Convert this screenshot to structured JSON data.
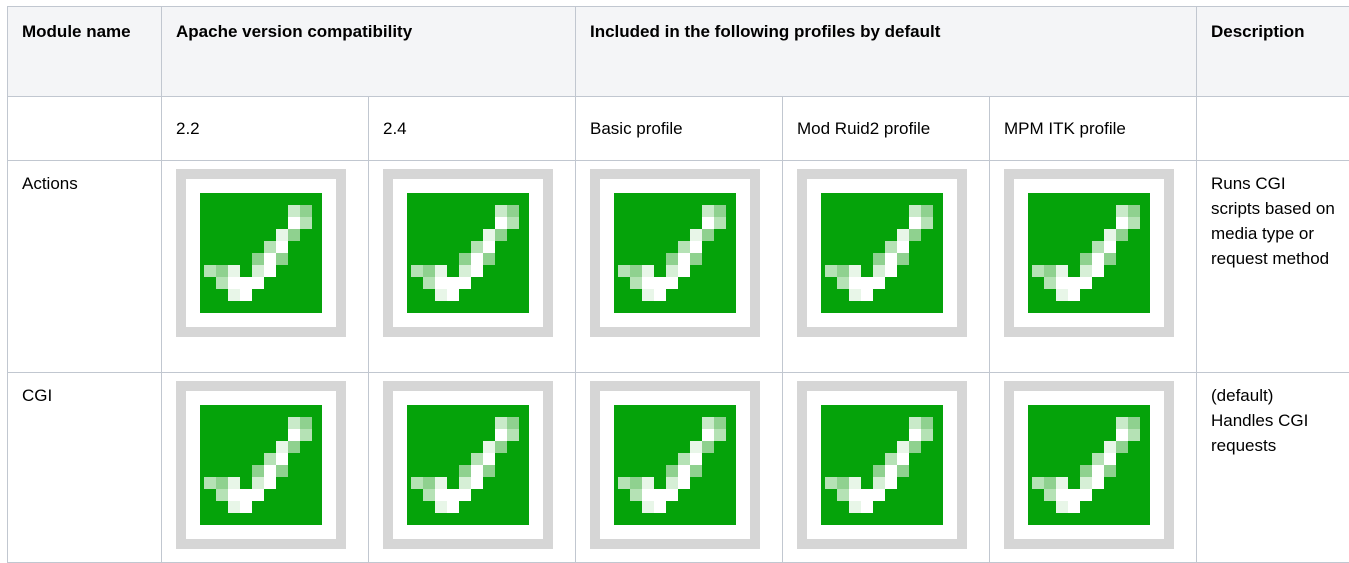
{
  "table": {
    "headers": {
      "module_name": "Module name",
      "apache_version": "Apache version compatibility",
      "profiles": "Included in the following profiles by default",
      "description": "Description"
    },
    "subheaders": {
      "module_name": "",
      "v22": "2.2",
      "v24": "2.4",
      "basic": "Basic profile",
      "ruid2": "Mod Ruid2 profile",
      "itk": "MPM ITK profile",
      "description": ""
    },
    "rows": [
      {
        "module": "Actions",
        "v22": "check-icon",
        "v24": "check-icon",
        "basic": "check-icon",
        "ruid2": "check-icon",
        "itk": "check-icon",
        "description": "Runs CGI scripts based on media type or request method"
      },
      {
        "module": "CGI",
        "v22": "check-icon",
        "v24": "check-icon",
        "basic": "check-icon",
        "ruid2": "check-icon",
        "itk": "check-icon",
        "description": "(default) Handles CGI requests"
      }
    ]
  },
  "colors": {
    "check_green": "#05a30a",
    "check_frame": "#d6d6d6",
    "header_bg": "#f4f5f7",
    "border": "#c1c7d0"
  }
}
